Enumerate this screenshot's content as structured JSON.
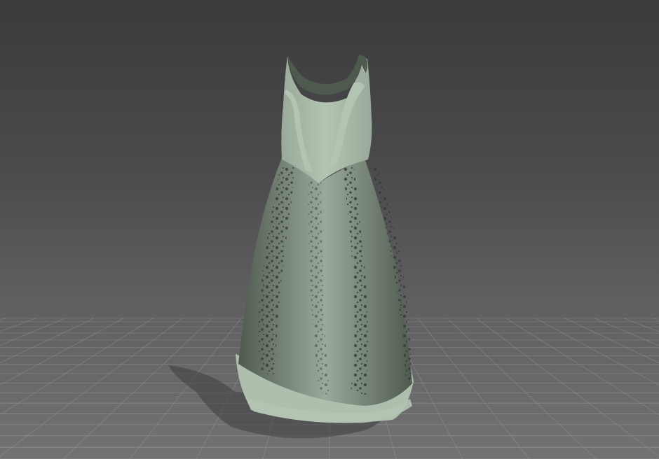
{
  "scene": {
    "colors": {
      "background_top": "#3b3b3d",
      "background_bottom": "#727274",
      "grid_line": "#9a9a9c",
      "garment_main": "#9aaa9a",
      "garment_light": "#b4c4b2",
      "garment_dark": "#4f5a4f",
      "lace_dark": "#2f3a30",
      "hem_trim": "#aebfae",
      "shadow": "#3e3e40"
    },
    "objects": [
      {
        "name": "ground-grid"
      },
      {
        "name": "garment-shadow"
      },
      {
        "name": "dress-3d-model"
      }
    ]
  }
}
